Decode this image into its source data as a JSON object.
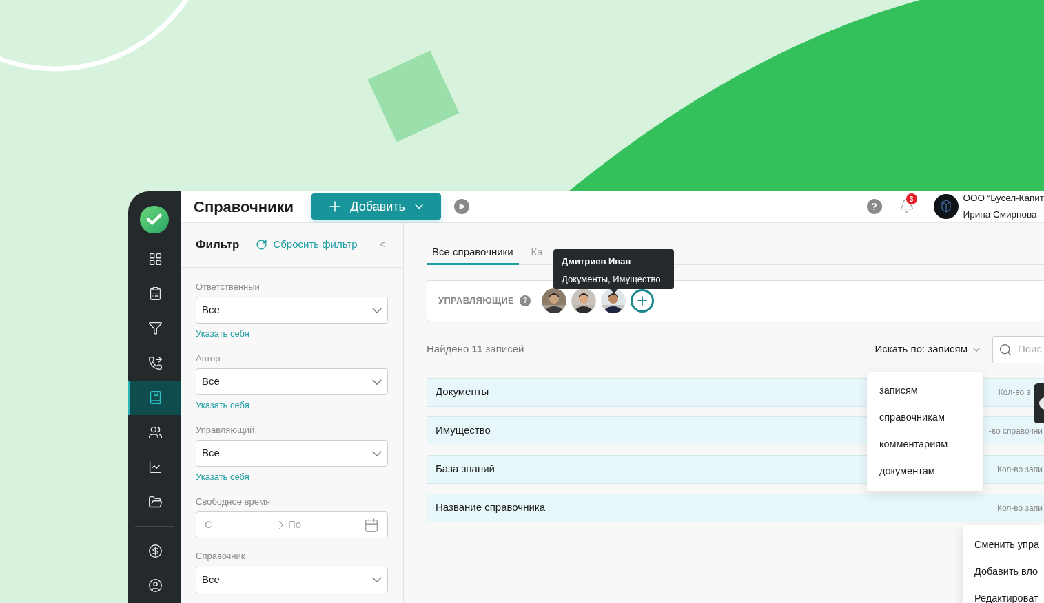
{
  "sidebar": {
    "items": [
      {
        "selected": false
      },
      {
        "selected": false
      },
      {
        "selected": false
      },
      {
        "selected": false
      },
      {
        "selected": true
      },
      {
        "selected": false
      },
      {
        "selected": false
      },
      {
        "selected": false
      },
      {
        "selected": false
      },
      {
        "selected": false
      }
    ]
  },
  "header": {
    "title": "Справочники",
    "add_button": "Добавить",
    "notifications": "3",
    "company": "ООО “Бусел-Капит",
    "user": "Ирина Смирнова"
  },
  "filter": {
    "title": "Фильтр",
    "reset": "Сбросить фильтр",
    "collapse": "<",
    "fields": [
      {
        "kind": "select",
        "label": "Ответственный",
        "value": "Все",
        "link": "Указать себя"
      },
      {
        "kind": "select",
        "label": "Автор",
        "value": "Все",
        "link": "Указать себя"
      },
      {
        "kind": "select",
        "label": "Управляющий",
        "value": "Все",
        "link": "Указать себя"
      },
      {
        "kind": "date_range",
        "label": "Свободное время",
        "from_placeholder": "С",
        "to_placeholder": "По"
      },
      {
        "kind": "select",
        "label": "Справочник",
        "value": "Все"
      }
    ]
  },
  "tabs": [
    {
      "label": "Все справочники",
      "selected": true
    },
    {
      "label": "Ка",
      "selected": false
    }
  ],
  "tooltip": {
    "name": "Дмитриев Иван",
    "detail": "Документы, Имущество"
  },
  "managers": {
    "label": "УПРАВЛЯЮЩИЕ",
    "help": "?"
  },
  "found": "Найдено **11** записей",
  "search_by": "Искать по: записям",
  "search": {
    "placeholder": "Поис"
  },
  "search_options": [
    "записям",
    "справочникам",
    "комментариям",
    "документам"
  ],
  "rows": [
    {
      "name": "Документы",
      "meta": "Кол-во з"
    },
    {
      "name": "Имущество",
      "meta": "-во справочни"
    },
    {
      "name": "База знаний",
      "meta": "Кол-во запи"
    },
    {
      "name": "Название справочника",
      "meta": "Кол-во запи"
    }
  ],
  "context_menu": [
    "Сменить упра",
    "Добавить вло",
    "Редактироват"
  ]
}
